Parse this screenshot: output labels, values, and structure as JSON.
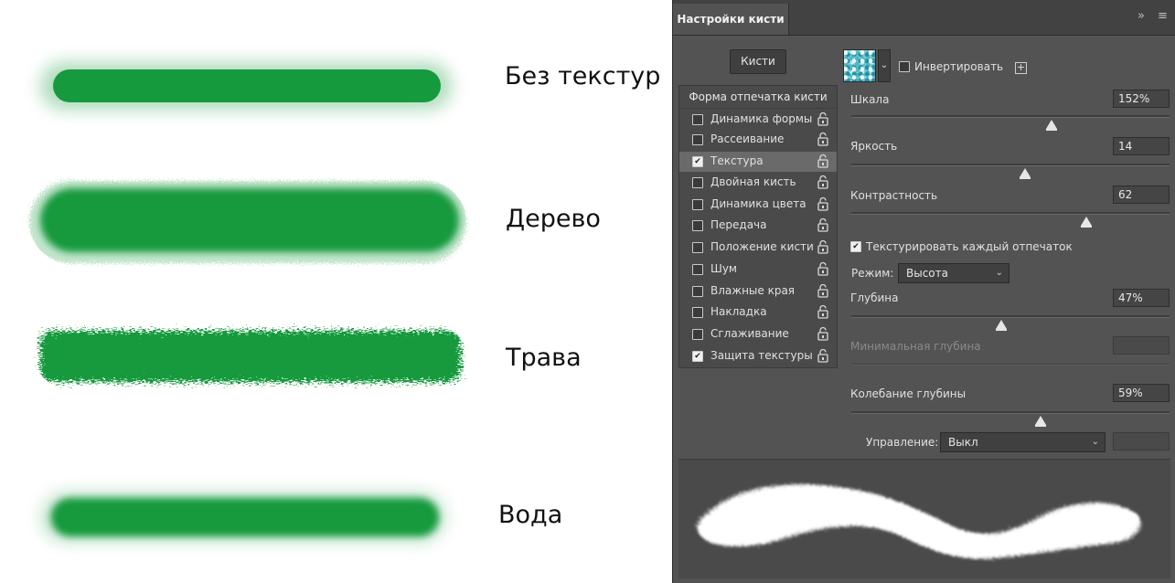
{
  "illustration": {
    "labels": [
      "Без текстур",
      "Дерево",
      "Трава",
      "Вода"
    ],
    "stroke_color": "#159a3d"
  },
  "panel": {
    "tab_title": "Настройки кисти",
    "collapse_glyph": "»",
    "menu_glyph": "≡",
    "brushes_button": "Кисти",
    "list_header": "Форма отпечатка кисти",
    "items": [
      {
        "label": "Динамика формы",
        "checked": false
      },
      {
        "label": "Рассеивание",
        "checked": false
      },
      {
        "label": "Текстура",
        "checked": true,
        "active": true
      },
      {
        "label": "Двойная кисть",
        "checked": false
      },
      {
        "label": "Динамика цвета",
        "checked": false
      },
      {
        "label": "Передача",
        "checked": false
      },
      {
        "label": "Положение кисти",
        "checked": false
      },
      {
        "label": "Шум",
        "checked": false
      },
      {
        "label": "Влажные края",
        "checked": false
      },
      {
        "label": "Накладка",
        "checked": false
      },
      {
        "label": "Сглаживание",
        "checked": false
      },
      {
        "label": "Защита текстуры",
        "checked": true
      }
    ],
    "invert_label": "Инвертировать",
    "invert_checked": false,
    "scale": {
      "label": "Шкала",
      "value": "152%"
    },
    "brightness": {
      "label": "Яркость",
      "value": "14"
    },
    "contrast": {
      "label": "Контрастность",
      "value": "62"
    },
    "texture_each_label": "Текстурировать каждый отпечаток",
    "texture_each_checked": true,
    "mode": {
      "label": "Режим:",
      "value": "Высота"
    },
    "depth": {
      "label": "Глубина",
      "value": "47%"
    },
    "min_depth": {
      "label": "Минимальная глубина",
      "value": ""
    },
    "depth_jitter": {
      "label": "Колебание глубины",
      "value": "59%"
    },
    "control": {
      "label": "Управление:",
      "value": "Выкл"
    },
    "slider_levels": {
      "scale": 0.63,
      "brightness": 0.546,
      "contrast": 0.738,
      "depth": 0.472,
      "depth_jitter": 0.595
    }
  }
}
